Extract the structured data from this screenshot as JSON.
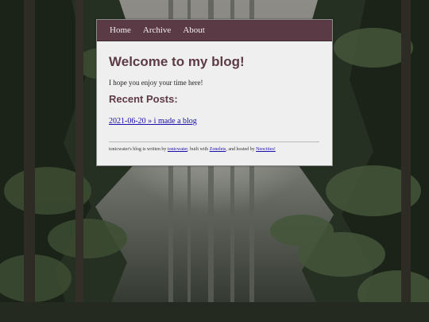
{
  "nav": {
    "items": [
      "Home",
      "Archive",
      "About"
    ]
  },
  "main": {
    "title": "Welcome to my blog!",
    "intro": "I hope you enjoy your time here!",
    "recent_heading": "Recent Posts:",
    "posts": [
      {
        "label": "2021-06-20 » i made a blog"
      }
    ]
  },
  "footer": {
    "prefix": "tonicwater's blog is written by ",
    "author_link": "tonicwater",
    "middle1": ", built with ",
    "builder_link": "Zonelets",
    "middle2": ", and hosted by ",
    "host_link": "Neocities!"
  },
  "colors": {
    "nav_bg": "#5a3a44",
    "heading": "#5c3b45",
    "card_bg": "#efefef",
    "link": "#1a0dab"
  }
}
